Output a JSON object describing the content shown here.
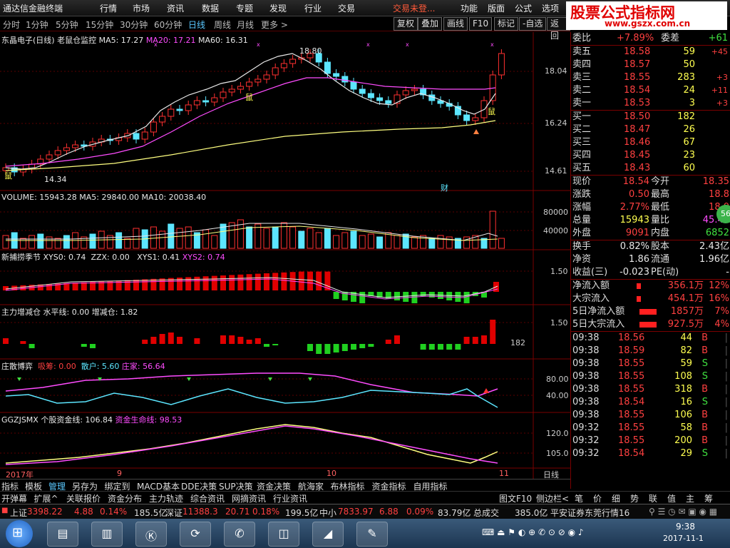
{
  "menu": {
    "app_title": "通达信金融终端",
    "items": [
      "行情",
      "市场",
      "资讯",
      "数据",
      "专题",
      "发现",
      "行业",
      "交易"
    ],
    "trade_status": "交易未登...",
    "right_items": [
      "功能",
      "版面",
      "公式",
      "选项"
    ]
  },
  "watermark": {
    "title": "股票公式指标网",
    "url": "www.gszx.com.cn"
  },
  "tabs": {
    "items": [
      "分时",
      "1分钟",
      "5分钟",
      "15分钟",
      "30分钟",
      "60分钟",
      "日线",
      "周线",
      "月线",
      "更多 >"
    ],
    "active": "日线"
  },
  "toolbar": {
    "buttons": [
      "复权",
      "叠加",
      "画线",
      "F10",
      "标记",
      "-自选",
      "返回"
    ]
  },
  "main_chart": {
    "title": "东晶电子(日线) 老鼠仓监控",
    "ma5": "MA5: 17.27",
    "ma20": "MA20: 17.21",
    "ma60": "MA60: 16.31",
    "high_label": "18.80",
    "low_label": "14.34",
    "mouse_label": "鼠",
    "cai_label": "财",
    "axis": [
      "18.04",
      "16.24",
      "14.61"
    ]
  },
  "volume_panel": {
    "label": "VOLUME: 15943.28",
    "ma5": "MA5: 29840.00",
    "ma10": "MA10: 20038.40",
    "axis": [
      "80000",
      "40000"
    ]
  },
  "season_panel": {
    "label": "新捕捞季节",
    "xys0": "XYS0: 0.74",
    "zzx": "ZZX: 0.00",
    "xys1": "XYS1: 0.41",
    "xys2": "XYS2: 0.74",
    "axis": "1.50"
  },
  "zhucang_panel": {
    "label": "主力增减仓",
    "level": "水平线: 0.00",
    "change": "增减仓: 1.82",
    "axis": "1.50",
    "value": "182"
  },
  "game_panel": {
    "label": "庄散博弈",
    "chouma": "吸筹: 0.00",
    "sanhu": "散户: 5.60",
    "zhuangjia": "庄家: 56.64",
    "axis": [
      "80.00",
      "40.00"
    ]
  },
  "ggzj_panel": {
    "label": "GGZJSMX 个股资金线: 106.84",
    "life": "资金生命线: 98.53",
    "axis": [
      "120.0",
      "105.0"
    ]
  },
  "date_axis": {
    "labels": [
      "2017年",
      "9",
      "10",
      "11"
    ],
    "period": "日线"
  },
  "quote": {
    "weibi_label": "委比",
    "weibi": "+7.89%",
    "weicha_label": "委差",
    "weicha": "+61",
    "sells": [
      {
        "name": "卖五",
        "price": "18.58",
        "vol": "59",
        "chg": "+45"
      },
      {
        "name": "卖四",
        "price": "18.57",
        "vol": "50",
        "chg": ""
      },
      {
        "name": "卖三",
        "price": "18.55",
        "vol": "283",
        "chg": "+3"
      },
      {
        "name": "卖二",
        "price": "18.54",
        "vol": "24",
        "chg": "+11"
      },
      {
        "name": "卖一",
        "price": "18.53",
        "vol": "3",
        "chg": "+3"
      }
    ],
    "buys": [
      {
        "name": "买一",
        "price": "18.50",
        "vol": "182"
      },
      {
        "name": "买二",
        "price": "18.47",
        "vol": "26"
      },
      {
        "name": "买三",
        "price": "18.46",
        "vol": "67"
      },
      {
        "name": "买四",
        "price": "18.45",
        "vol": "23"
      },
      {
        "name": "买五",
        "price": "18.43",
        "vol": "60"
      }
    ],
    "stats": [
      {
        "k1": "现价",
        "v1": "18.54",
        "k2": "今开",
        "v2": "18.35"
      },
      {
        "k1": "涨跌",
        "v1": "0.50",
        "k2": "最高",
        "v2": "18.8"
      },
      {
        "k1": "涨幅",
        "v1": "2.77%",
        "k2": "最低",
        "v2": "18.0"
      },
      {
        "k1": "总量",
        "v1": "15943",
        "k2": "量比",
        "v2": "45.42"
      },
      {
        "k1": "外盘",
        "v1": "9091",
        "k2": "内盘",
        "v2": "6852"
      }
    ],
    "stats2": [
      {
        "k1": "换手",
        "v1": "0.82%",
        "k2": "股本",
        "v2": "2.43亿"
      },
      {
        "k1": "净资",
        "v1": "1.86",
        "k2": "流通",
        "v2": "1.96亿"
      },
      {
        "k1": "收益(三)",
        "v1": "-0.023",
        "k2": "PE(动)",
        "v2": "-"
      }
    ],
    "flows": [
      {
        "k": "净流入额",
        "v": "356.1万",
        "p": "12%"
      },
      {
        "k": "大宗流入",
        "v": "454.1万",
        "p": "16%"
      },
      {
        "k": "5日净流入额",
        "v": "1857万",
        "p": "7%"
      },
      {
        "k": "5日大宗流入",
        "v": "927.5万",
        "p": "4%"
      }
    ],
    "ticks": [
      {
        "t": "09:38",
        "p": "18.56",
        "v": "44",
        "s": "B"
      },
      {
        "t": "09:38",
        "p": "18.59",
        "v": "82",
        "s": "B"
      },
      {
        "t": "09:38",
        "p": "18.55",
        "v": "59",
        "s": "S"
      },
      {
        "t": "09:38",
        "p": "18.55",
        "v": "108",
        "s": "S"
      },
      {
        "t": "09:38",
        "p": "18.55",
        "v": "318",
        "s": "B"
      },
      {
        "t": "09:38",
        "p": "18.54",
        "v": "16",
        "s": "S"
      },
      {
        "t": "09:38",
        "p": "18.55",
        "v": "106",
        "s": "B"
      },
      {
        "t": "09:32",
        "p": "18.55",
        "v": "58",
        "s": "B"
      },
      {
        "t": "09:32",
        "p": "18.55",
        "v": "200",
        "s": "B"
      },
      {
        "t": "09:32",
        "p": "18.54",
        "v": "29",
        "s": "S"
      }
    ],
    "badge": "56"
  },
  "bottom_tabs1": [
    "指标",
    "模板",
    "管理",
    "另存为",
    "绑定到",
    "MACD基本",
    "DDE决策",
    "SUP决策",
    "资金决策",
    "航海家",
    "布林指标",
    "资金指标",
    "自用指标"
  ],
  "bottom_tabs1_active": "管理",
  "bottom_tabs2": [
    "开弹幕",
    "扩展^",
    "关联报价",
    "资金分布",
    "主力轨迹",
    "综合资讯",
    "网摘资讯",
    "行业资讯"
  ],
  "side_tabs": [
    "图文F10",
    "侧边栏<",
    "笔",
    "价",
    "细",
    "势",
    "联",
    "值",
    "主",
    "筹"
  ],
  "ticker": {
    "sh_label": "上证",
    "sh": "3398.22",
    "sh_chg": "4.88",
    "sh_pct": "0.14%",
    "sh_amt": "185.5亿",
    "sz_label": "深证",
    "sz": "11388.3",
    "sz_chg": "20.71",
    "sz_pct": "0.18%",
    "sz_amt": "199.5亿",
    "zx_label": "中小",
    "zx": "7833.97",
    "zx_chg": "6.88",
    "zx_pct": "0.09%",
    "zx_amt": "83.79亿",
    "total_label": "总成交",
    "total": "385.0亿",
    "broker": "平安证券东莞行情16"
  },
  "clock": {
    "time": "9:38",
    "date": "2017-11-1"
  }
}
